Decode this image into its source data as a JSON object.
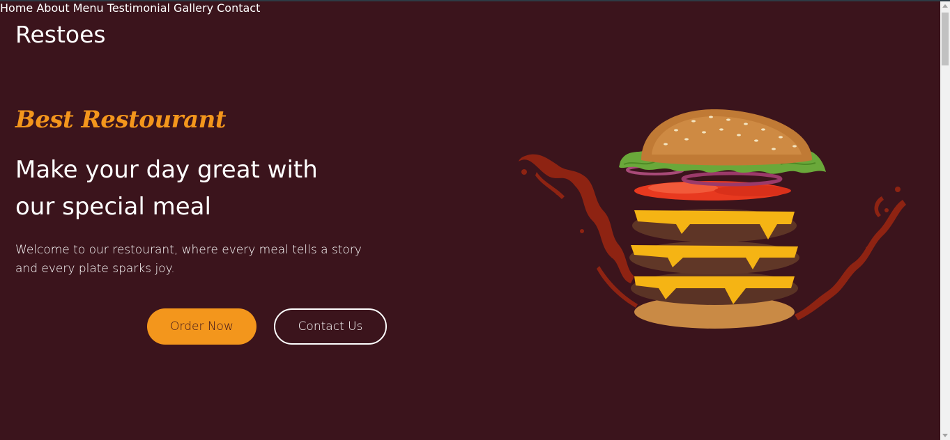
{
  "brand": {
    "logo": "Restoes"
  },
  "nav": {
    "items": [
      {
        "label": "Home"
      },
      {
        "label": "About"
      },
      {
        "label": "Menu"
      },
      {
        "label": "Testimonial"
      },
      {
        "label": "Gallery"
      },
      {
        "label": "Contact"
      }
    ]
  },
  "hero": {
    "subtitle": "Best Restourant",
    "title_line1": "Make your day great with",
    "title_line2": "our special meal",
    "description": "Welcome to our restourant, where every meal tells a story and every plate sparks joy.",
    "order_button": "Order Now",
    "contact_button": "Contact Us",
    "image_subject": "burger-image"
  },
  "colors": {
    "background": "#3b141c",
    "accent": "#f3961c",
    "text": "#ffffff"
  }
}
